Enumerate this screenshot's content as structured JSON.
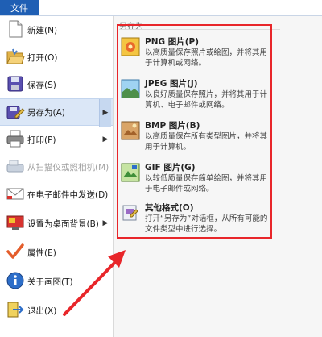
{
  "ribbon": {
    "file_tab": "文件"
  },
  "menu": {
    "items": [
      {
        "label": "新建(N)",
        "icon": "new-file-icon",
        "submenu": false,
        "disabled": false
      },
      {
        "label": "打开(O)",
        "icon": "open-folder-icon",
        "submenu": false,
        "disabled": false
      },
      {
        "label": "保存(S)",
        "icon": "save-disk-icon",
        "submenu": false,
        "disabled": false
      },
      {
        "label": "另存为(A)",
        "icon": "save-as-icon",
        "submenu": true,
        "disabled": false,
        "active": true
      },
      {
        "label": "打印(P)",
        "icon": "printer-icon",
        "submenu": true,
        "disabled": false
      },
      {
        "label": "从扫描仪或照相机(M)",
        "icon": "scanner-icon",
        "submenu": false,
        "disabled": true
      },
      {
        "label": "在电子邮件中发送(D)",
        "icon": "email-icon",
        "submenu": false,
        "disabled": false
      },
      {
        "label": "设置为桌面背景(B)",
        "icon": "desktop-background-icon",
        "submenu": true,
        "disabled": false
      },
      {
        "label": "属性(E)",
        "icon": "checkmark-icon",
        "submenu": false,
        "disabled": false
      },
      {
        "label": "关于画图(T)",
        "icon": "info-icon",
        "submenu": false,
        "disabled": false
      },
      {
        "label": "退出(X)",
        "icon": "exit-icon",
        "submenu": false,
        "disabled": false
      }
    ]
  },
  "save_as_panel": {
    "title": "另存为",
    "options": [
      {
        "title": "PNG 图片(P)",
        "desc": "以高质量保存照片或绘图，并将其用于计算机或网络。",
        "icon": "png-image-icon"
      },
      {
        "title": "JPEG 图片(J)",
        "desc": "以良好质量保存照片，并将其用于计算机、电子邮件或网络。",
        "icon": "jpeg-image-icon"
      },
      {
        "title": "BMP 图片(B)",
        "desc": "以高质量保存所有类型图片，并将其用于计算机。",
        "icon": "bmp-image-icon"
      },
      {
        "title": "GIF 图片(G)",
        "desc": "以较低质量保存简单绘图，并将其用于电子邮件或网络。",
        "icon": "gif-image-icon"
      },
      {
        "title": "其他格式(O)",
        "desc": "打开“另存为”对话框，从所有可能的文件类型中进行选择。",
        "icon": "other-formats-icon"
      }
    ]
  },
  "colors": {
    "highlight": "#e8262a",
    "file_tab": "#1f5fb4",
    "active_item": "#dbe7f7"
  }
}
